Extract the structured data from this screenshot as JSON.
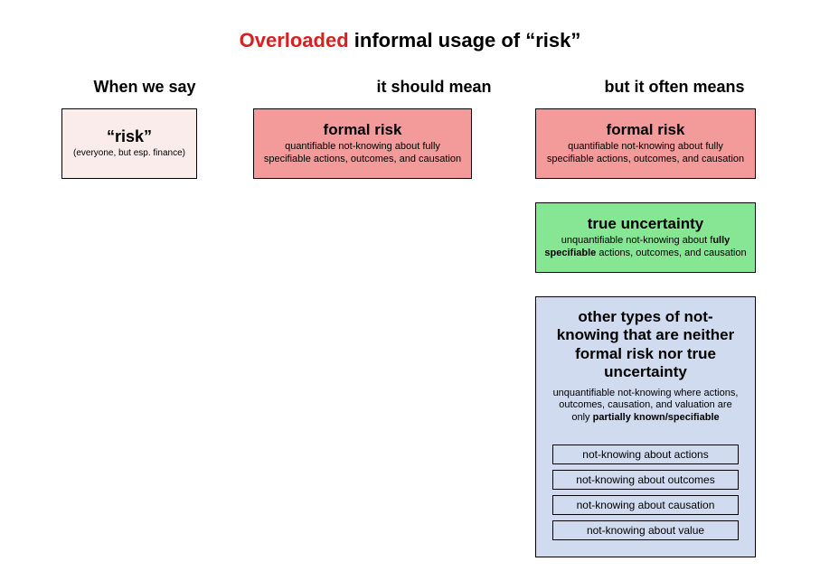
{
  "title": {
    "overloaded": "Overloaded",
    "rest": " informal usage of “risk”"
  },
  "headers": {
    "col1": "When we say",
    "col2": "it should mean",
    "col3": "but it often means"
  },
  "col1": {
    "risk": {
      "title": "“risk”",
      "sub": "(everyone, but esp. finance)"
    }
  },
  "col2": {
    "formal": {
      "title": "formal risk",
      "sub": "quantifiable not-knowing about fully specifiable actions, outcomes, and causation"
    }
  },
  "col3": {
    "formal": {
      "title": "formal risk",
      "sub": "quantifiable not-knowing about fully specifiable actions, outcomes, and causation"
    },
    "uncertainty": {
      "title": "true uncertainty",
      "sub_pre": "unquantifiable not-knowing about f",
      "sub_bold": "ully specifiable",
      "sub_post": " actions, outcomes, and causation"
    },
    "other": {
      "title": "other types of not-knowing that are neither formal risk nor true uncertainty",
      "sub_pre": "unquantifiable not-knowing where actions, outcomes, causation, and valuation are only ",
      "sub_bold": "partially known/specifiable",
      "items": [
        "not-knowing about actions",
        "not-knowing about outcomes",
        "not-knowing about causation",
        "not-knowing about value"
      ]
    }
  }
}
